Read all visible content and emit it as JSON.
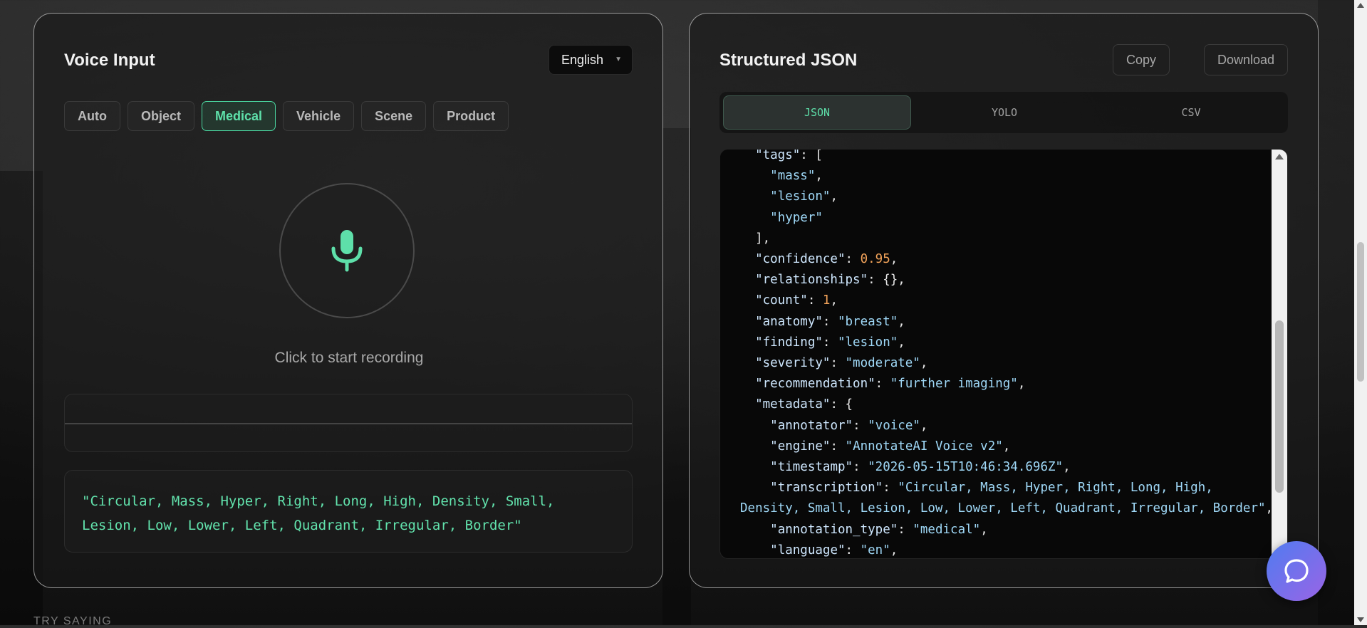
{
  "voice_panel": {
    "title": "Voice Input",
    "language": "English",
    "modes": [
      {
        "label": "Auto",
        "active": false
      },
      {
        "label": "Object",
        "active": false
      },
      {
        "label": "Medical",
        "active": true
      },
      {
        "label": "Vehicle",
        "active": false
      },
      {
        "label": "Scene",
        "active": false
      },
      {
        "label": "Product",
        "active": false
      }
    ],
    "record_hint": "Click to start recording",
    "transcript": "\"Circular, Mass, Hyper, Right, Long, High, Density, Small, Lesion, Low, Lower, Left, Quadrant, Irregular, Border\""
  },
  "json_panel": {
    "title": "Structured JSON",
    "copy_label": "Copy",
    "download_label": "Download",
    "tabs": [
      {
        "label": "JSON",
        "active": true
      },
      {
        "label": "YOLO",
        "active": false
      },
      {
        "label": "CSV",
        "active": false
      }
    ],
    "code_lines": [
      {
        "indent": 1,
        "key": "tags",
        "punct": "[",
        "type": "open"
      },
      {
        "indent": 2,
        "str": "mass",
        "comma": true
      },
      {
        "indent": 2,
        "str": "lesion",
        "comma": true
      },
      {
        "indent": 2,
        "str": "hyper",
        "comma": false
      },
      {
        "indent": 1,
        "text": "],"
      },
      {
        "indent": 1,
        "key": "confidence",
        "num": "0.95"
      },
      {
        "indent": 1,
        "key": "relationships",
        "raw": "{}"
      },
      {
        "indent": 1,
        "key": "count",
        "num": "1"
      },
      {
        "indent": 1,
        "key": "anatomy",
        "val": "breast"
      },
      {
        "indent": 1,
        "key": "finding",
        "val": "lesion"
      },
      {
        "indent": 1,
        "key": "severity",
        "val": "moderate"
      },
      {
        "indent": 1,
        "key": "recommendation",
        "val": "further imaging"
      },
      {
        "indent": 1,
        "key": "metadata",
        "punct": "{",
        "type": "open"
      },
      {
        "indent": 2,
        "key": "annotator",
        "val": "voice"
      },
      {
        "indent": 2,
        "key": "engine",
        "val": "AnnotateAI Voice v2"
      },
      {
        "indent": 2,
        "key": "timestamp",
        "val": "2026-05-15T10:46:34.696Z"
      },
      {
        "indent": 2,
        "key": "transcription",
        "val_start": "Circular, Mass, Hyper, Right, Long, High,"
      },
      {
        "indent": 0,
        "wrap": "Density, Small, Lesion, Low, Lower, Left, Quadrant, Irregular, Border"
      },
      {
        "indent": 2,
        "key": "annotation_type",
        "val": "medical"
      },
      {
        "indent": 2,
        "key": "language",
        "val": "en"
      }
    ]
  },
  "footer": {
    "try_saying": "TRY SAYING"
  },
  "colors": {
    "accent": "#5ee0aa",
    "json_number": "#f2a35a",
    "json_string": "#9fd8f7",
    "chat_gradient_start": "#4f7cf0",
    "chat_gradient_end": "#9a64e6"
  },
  "icons": {
    "mic": "microphone-icon",
    "chat": "chat-bubble-icon",
    "dropdown": "chevron-down-icon"
  }
}
